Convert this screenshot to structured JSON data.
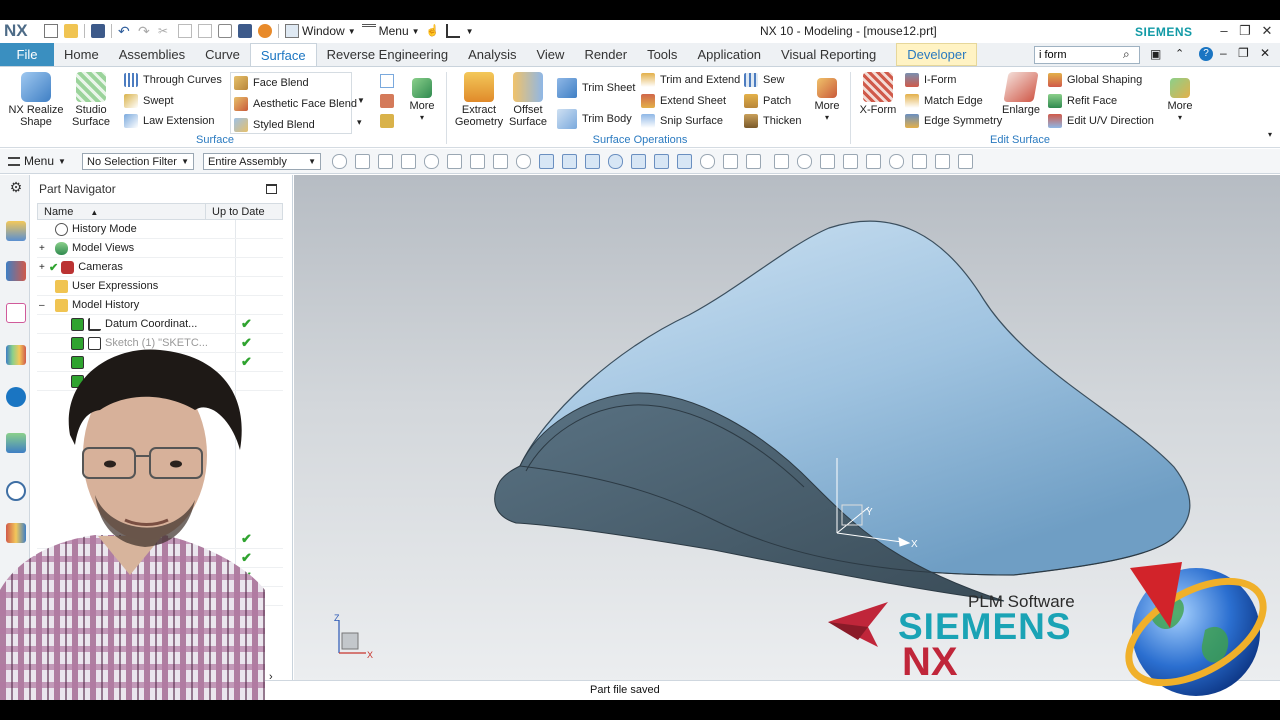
{
  "app": {
    "logo": "NX",
    "title": "NX 10 - Modeling - [mouse12.prt]",
    "brand": "SIEMENS",
    "window_menu": "Window",
    "menu_menu": "Menu"
  },
  "tabs": [
    "File",
    "Home",
    "Assemblies",
    "Curve",
    "Surface",
    "Reverse Engineering",
    "Analysis",
    "View",
    "Render",
    "Tools",
    "Application",
    "Visual Reporting",
    "Developer"
  ],
  "active_tab": "Surface",
  "search": {
    "value": "i form"
  },
  "ribbon": {
    "surface_group": {
      "label": "Surface",
      "nx_realize_shape": "NX Realize Shape",
      "studio_surface": "Studio Surface",
      "through_curves": "Through Curves",
      "swept": "Swept",
      "law_extension": "Law Extension",
      "face_blend": "Face Blend",
      "aesthetic_face_blend": "Aesthetic Face Blend",
      "styled_blend": "Styled Blend",
      "more": "More"
    },
    "surface_operations": {
      "label": "Surface Operations",
      "extract_geometry": "Extract Geometry",
      "offset_surface": "Offset Surface",
      "trim_sheet": "Trim Sheet",
      "trim_body": "Trim Body",
      "trim_and_extend": "Trim and Extend",
      "extend_sheet": "Extend Sheet",
      "snip_surface": "Snip Surface",
      "sew": "Sew",
      "patch": "Patch",
      "thicken": "Thicken",
      "more": "More"
    },
    "edit_surface": {
      "label": "Edit Surface",
      "x_form": "X-Form",
      "i_form": "I-Form",
      "match_edge": "Match Edge",
      "edge_symmetry": "Edge Symmetry",
      "enlarge": "Enlarge",
      "global_shaping": "Global Shaping",
      "refit_face": "Refit Face",
      "edit_uv_direction": "Edit U/V Direction",
      "more": "More"
    }
  },
  "toolbar": {
    "menu": "Menu",
    "selection_filter": "No Selection Filter",
    "assembly_scope": "Entire Assembly"
  },
  "navigator": {
    "title": "Part Navigator",
    "col_name": "Name",
    "col_uptodate": "Up to Date",
    "rows": [
      {
        "label": "History Mode",
        "check": ""
      },
      {
        "label": "Model Views",
        "check": ""
      },
      {
        "label": "Cameras",
        "check": ""
      },
      {
        "label": "User Expressions",
        "check": ""
      },
      {
        "label": "Model History",
        "check": ""
      },
      {
        "label": "Datum Coordinat...",
        "check": "✔"
      },
      {
        "label": "Sketch (1) \"SKETC...",
        "check": "✔"
      }
    ]
  },
  "viewport": {
    "triad_labels": {
      "x": "X",
      "y": "Y",
      "z": "Z"
    }
  },
  "watermark": {
    "plm": "PLM Software",
    "siemens": "SIEMENS",
    "nx": "NX"
  },
  "status": {
    "text": "Part file saved"
  },
  "colors": {
    "accent": "#1a75c2",
    "file_tab": "#3a8fc0",
    "surface_body": "#a9cbe4",
    "surface_shadow": "#4a6070",
    "siemens_teal": "#1aa3b5",
    "nx_red": "#c0263a"
  }
}
